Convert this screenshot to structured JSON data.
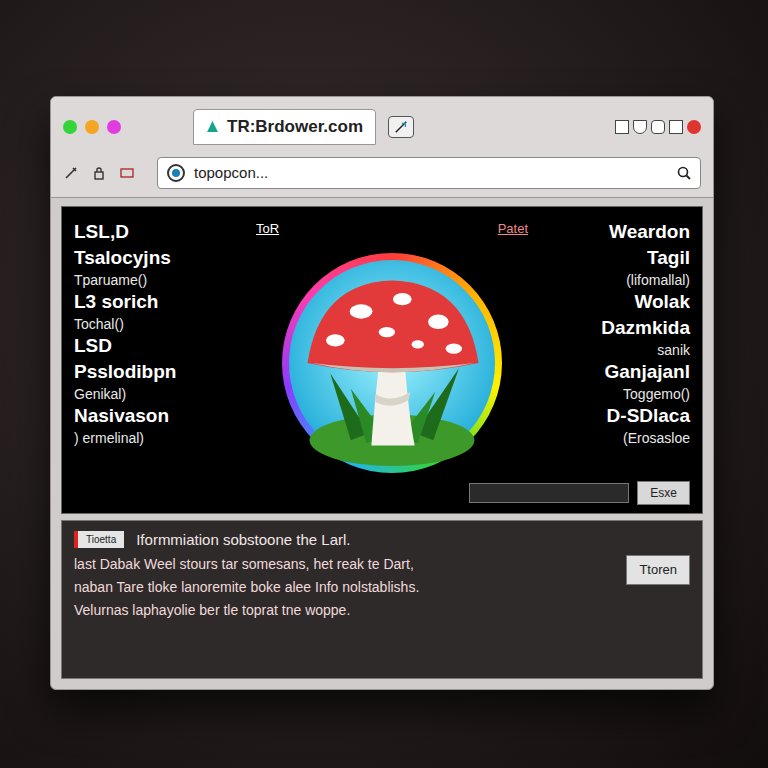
{
  "window": {
    "title": "TR:Brdower.com",
    "lights": [
      {
        "color": "#35d43a"
      },
      {
        "color": "#f5a524"
      },
      {
        "color": "#e23ce0"
      }
    ]
  },
  "address_bar": {
    "url": "topopcon..."
  },
  "header": {
    "left": "ToR",
    "right": "Patet"
  },
  "left_list": [
    {
      "text": "LSL,D",
      "kind": "title"
    },
    {
      "text": "Tsalocyjns",
      "kind": "title"
    },
    {
      "text": "Tparuame()",
      "kind": "note"
    },
    {
      "text": "L3 sorich",
      "kind": "title"
    },
    {
      "text": "Tochal()",
      "kind": "note"
    },
    {
      "text": "LSD",
      "kind": "title"
    },
    {
      "text": "Psslodibpn",
      "kind": "title"
    },
    {
      "text": "Genikal)",
      "kind": "note"
    },
    {
      "text": "Nasivason",
      "kind": "title"
    },
    {
      "text": ") ermelinal)",
      "kind": "note"
    }
  ],
  "right_list": [
    {
      "text": "Weardon",
      "kind": "title"
    },
    {
      "text": "Tagil",
      "kind": "title"
    },
    {
      "text": "(lifomallal)",
      "kind": "note"
    },
    {
      "text": "Wolak",
      "kind": "title"
    },
    {
      "text": "Dazmkida",
      "kind": "title"
    },
    {
      "text": "sanik",
      "kind": "note"
    },
    {
      "text": "Ganjajanl",
      "kind": "title"
    },
    {
      "text": "Toggemo()",
      "kind": "note"
    },
    {
      "text": "D-SDlaca",
      "kind": "title"
    },
    {
      "text": "(Erosasloe",
      "kind": "note"
    }
  ],
  "search": {
    "button": "Esxe"
  },
  "info": {
    "tag": "Tioetta",
    "heading": "Iformmiation sobstoone the Larl.",
    "lines": [
      "last Dabak Weel stours tar somesans, het reak te Dart,",
      "naban Tare tloke lanoremite boke alee Info nolstablishs.",
      "Velurnas laphayolie ber tle toprat tne woppe."
    ],
    "button": "Ttoren"
  }
}
